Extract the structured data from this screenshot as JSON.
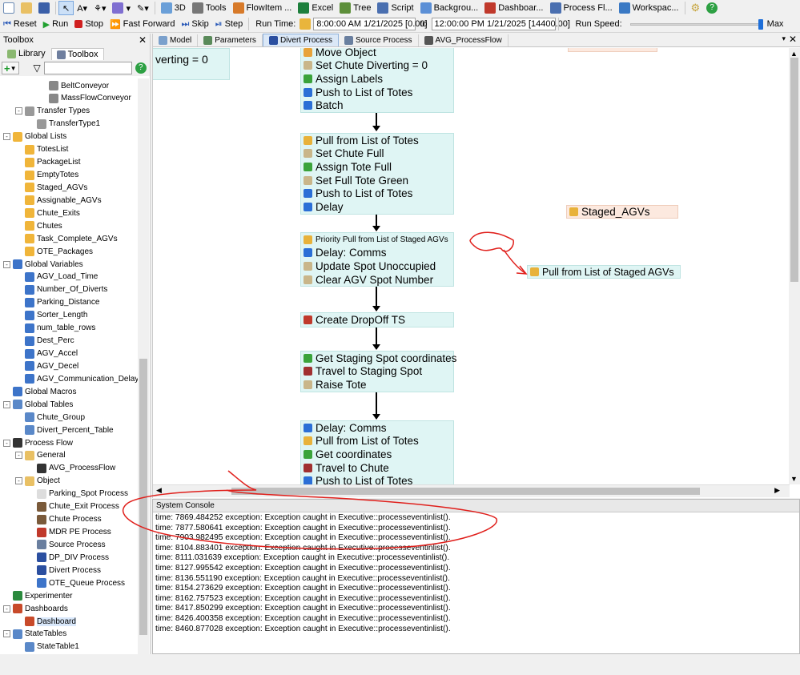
{
  "toolbar1": {
    "items": [
      {
        "label": "3D",
        "icon": "3d-view-icon"
      },
      {
        "label": "Tools",
        "icon": "tools-icon"
      },
      {
        "label": "FlowItem ...",
        "icon": "flowitem-icon"
      },
      {
        "label": "Excel",
        "icon": "excel-icon"
      },
      {
        "label": "Tree",
        "icon": "tree-icon"
      },
      {
        "label": "Script",
        "icon": "script-icon"
      },
      {
        "label": "Backgrou...",
        "icon": "background-icon"
      },
      {
        "label": "Dashboar...",
        "icon": "dashboard-icon"
      },
      {
        "label": "Process Fl...",
        "icon": "process-flow-icon"
      },
      {
        "label": "Workspac...",
        "icon": "workspace-icon"
      }
    ]
  },
  "toolbar2": {
    "reset": "Reset",
    "run": "Run",
    "stop": "Stop",
    "fast_forward": "Fast Forward",
    "skip": "Skip",
    "step": "Step",
    "run_time_label": "Run Time:",
    "start_time": "8:00:00 AM  1/21/2025 [0.00]",
    "to": "to",
    "end_time": "12:00:00 PM  1/21/2025 [14400.00]",
    "run_speed_label": "Run Speed:",
    "run_speed_level": 0.97,
    "max_label": "Max"
  },
  "toolbox": {
    "title": "Toolbox",
    "tabs": [
      "Library",
      "Toolbox"
    ],
    "filter_value": "",
    "tree": [
      {
        "indent": 3,
        "label": "BeltConveyor",
        "icon": "conveyor-icon",
        "expander": ""
      },
      {
        "indent": 3,
        "label": "MassFlowConveyor",
        "icon": "conveyor-icon",
        "expander": ""
      },
      {
        "indent": 1,
        "label": "Transfer Types",
        "icon": "transfer-icon",
        "expander": "-"
      },
      {
        "indent": 2,
        "label": "TransferType1",
        "icon": "transfer-icon",
        "expander": ""
      },
      {
        "indent": 0,
        "label": "Global Lists",
        "icon": "list-icon",
        "expander": "-"
      },
      {
        "indent": 1,
        "label": "TotesList",
        "icon": "list-icon",
        "expander": ""
      },
      {
        "indent": 1,
        "label": "PackageList",
        "icon": "list-icon",
        "expander": ""
      },
      {
        "indent": 1,
        "label": "EmptyTotes",
        "icon": "list-icon",
        "expander": ""
      },
      {
        "indent": 1,
        "label": "Staged_AGVs",
        "icon": "list-icon",
        "expander": ""
      },
      {
        "indent": 1,
        "label": "Assignable_AGVs",
        "icon": "list-icon",
        "expander": ""
      },
      {
        "indent": 1,
        "label": "Chute_Exits",
        "icon": "list-icon",
        "expander": ""
      },
      {
        "indent": 1,
        "label": "Chutes",
        "icon": "list-icon",
        "expander": ""
      },
      {
        "indent": 1,
        "label": "Task_Complete_AGVs",
        "icon": "list-icon",
        "expander": ""
      },
      {
        "indent": 1,
        "label": "OTE_Packages",
        "icon": "list-icon",
        "expander": ""
      },
      {
        "indent": 0,
        "label": "Global Variables",
        "icon": "variable-icon",
        "expander": "-"
      },
      {
        "indent": 1,
        "label": "AGV_Load_Time",
        "icon": "variable-icon",
        "expander": ""
      },
      {
        "indent": 1,
        "label": "Number_Of_Diverts",
        "icon": "variable-icon",
        "expander": ""
      },
      {
        "indent": 1,
        "label": "Parking_Distance",
        "icon": "variable-icon",
        "expander": ""
      },
      {
        "indent": 1,
        "label": "Sorter_Length",
        "icon": "variable-icon",
        "expander": ""
      },
      {
        "indent": 1,
        "label": "num_table_rows",
        "icon": "variable-icon",
        "expander": ""
      },
      {
        "indent": 1,
        "label": "Dest_Perc",
        "icon": "variable-icon",
        "expander": ""
      },
      {
        "indent": 1,
        "label": "AGV_Accel",
        "icon": "variable-icon",
        "expander": ""
      },
      {
        "indent": 1,
        "label": "AGV_Decel",
        "icon": "variable-icon",
        "expander": ""
      },
      {
        "indent": 1,
        "label": "AGV_Communication_Delay",
        "icon": "variable-icon",
        "expander": ""
      },
      {
        "indent": 0,
        "label": "Global Macros",
        "icon": "macro-icon",
        "expander": ""
      },
      {
        "indent": 0,
        "label": "Global Tables",
        "icon": "table-icon",
        "expander": "-"
      },
      {
        "indent": 1,
        "label": "Chute_Group",
        "icon": "table-icon",
        "expander": ""
      },
      {
        "indent": 1,
        "label": "Divert_Percent_Table",
        "icon": "table-icon",
        "expander": ""
      },
      {
        "indent": 0,
        "label": "Process Flow",
        "icon": "process-flow-icon",
        "expander": "-"
      },
      {
        "indent": 1,
        "label": "General",
        "icon": "folder-icon",
        "expander": "-"
      },
      {
        "indent": 2,
        "label": "AVG_ProcessFlow",
        "icon": "process-flow-icon",
        "expander": ""
      },
      {
        "indent": 1,
        "label": "Object",
        "icon": "folder-icon",
        "expander": "-"
      },
      {
        "indent": 2,
        "label": "Parking_Spot Process",
        "icon": "parking-icon",
        "expander": ""
      },
      {
        "indent": 2,
        "label": "Chute_Exit Process",
        "icon": "chute-icon",
        "expander": ""
      },
      {
        "indent": 2,
        "label": "Chute Process",
        "icon": "chute-icon",
        "expander": ""
      },
      {
        "indent": 2,
        "label": "MDR PE Process",
        "icon": "sensor-icon",
        "expander": ""
      },
      {
        "indent": 2,
        "label": "Source Process",
        "icon": "source-icon",
        "expander": ""
      },
      {
        "indent": 2,
        "label": "DP_DIV Process",
        "icon": "divert-icon",
        "expander": ""
      },
      {
        "indent": 2,
        "label": "Divert Process",
        "icon": "divert-icon",
        "expander": ""
      },
      {
        "indent": 2,
        "label": "OTE_Queue Process",
        "icon": "queue-icon",
        "expander": ""
      },
      {
        "indent": 0,
        "label": "Experimenter",
        "icon": "experimenter-icon",
        "expander": ""
      },
      {
        "indent": 0,
        "label": "Dashboards",
        "icon": "dashboard-icon",
        "expander": "-"
      },
      {
        "indent": 1,
        "label": "Dashboard",
        "icon": "dashboard-icon",
        "expander": "",
        "selected": true
      },
      {
        "indent": 0,
        "label": "StateTables",
        "icon": "table-icon",
        "expander": "-"
      },
      {
        "indent": 1,
        "label": "StateTable1",
        "icon": "table-icon",
        "expander": ""
      }
    ]
  },
  "editor": {
    "tabs": [
      {
        "label": "Model",
        "icon": "model-icon"
      },
      {
        "label": "Parameters",
        "icon": "parameters-icon"
      },
      {
        "label": "Divert Process",
        "icon": "divert-icon",
        "active": true
      },
      {
        "label": "Source Process",
        "icon": "source-icon"
      },
      {
        "label": "AVG_ProcessFlow",
        "icon": "process-flow-icon"
      }
    ],
    "partial_label": "verting = 0",
    "blocks": [
      {
        "activities": [
          {
            "label": "Move Object",
            "icon": "move-icon",
            "color": "#e8a33a"
          },
          {
            "label": "Set Chute Diverting = 0",
            "icon": "set-label-icon",
            "color": "#c9b68a"
          },
          {
            "label": "Assign Labels",
            "icon": "assign-labels-icon",
            "color": "#3aa33a"
          },
          {
            "label": "Push to List of Totes",
            "icon": "push-list-icon",
            "color": "#2b6fd6"
          },
          {
            "label": "Batch",
            "icon": "batch-icon",
            "color": "#2b6fd6"
          }
        ]
      },
      {
        "activities": [
          {
            "label": "Pull from List of Totes",
            "icon": "pull-list-icon",
            "color": "#e8b23a"
          },
          {
            "label": "Set Chute Full",
            "icon": "set-label-icon",
            "color": "#c9b68a"
          },
          {
            "label": "Assign Tote Full",
            "icon": "assign-labels-icon",
            "color": "#3aa33a"
          },
          {
            "label": "Set Full Tote Green",
            "icon": "set-label-icon",
            "color": "#c9b68a"
          },
          {
            "label": "Push to List of Totes",
            "icon": "push-list-icon",
            "color": "#2b6fd6"
          },
          {
            "label": "Delay",
            "icon": "delay-icon",
            "color": "#2b6fd6"
          }
        ]
      },
      {
        "activities": [
          {
            "label": "Priority Pull from List of Staged AGVs",
            "icon": "pull-list-icon",
            "color": "#e8b23a",
            "small": true
          },
          {
            "label": "Delay: Comms",
            "icon": "delay-icon",
            "color": "#2b6fd6"
          },
          {
            "label": "Update Spot Unoccupied",
            "icon": "set-label-icon",
            "color": "#c9b68a"
          },
          {
            "label": "Clear AGV Spot Number",
            "icon": "set-label-icon",
            "color": "#c9b68a"
          }
        ]
      },
      {
        "activities": [
          {
            "label": "Create DropOff TS",
            "icon": "create-task-icon",
            "color": "#c0392b"
          }
        ]
      },
      {
        "activities": [
          {
            "label": "Get Staging Spot coordinates",
            "icon": "assign-labels-icon",
            "color": "#3aa33a"
          },
          {
            "label": "Travel to Staging Spot",
            "icon": "travel-icon",
            "color": "#a03030"
          },
          {
            "label": "Raise Tote",
            "icon": "set-label-icon",
            "color": "#c9b68a"
          }
        ]
      },
      {
        "activities": [
          {
            "label": "Delay: Comms",
            "icon": "delay-icon",
            "color": "#2b6fd6"
          },
          {
            "label": "Pull from List of Totes",
            "icon": "pull-list-icon",
            "color": "#e8b23a"
          },
          {
            "label": "Get coordinates",
            "icon": "assign-labels-icon",
            "color": "#3aa33a"
          },
          {
            "label": "Travel to Chute",
            "icon": "travel-icon",
            "color": "#a03030"
          },
          {
            "label": "Push to List of Totes",
            "icon": "push-list-icon",
            "color": "#2b6fd6"
          }
        ]
      }
    ],
    "staged_agvs_label": "Staged_AGVs",
    "pull_staged_label": "Pull from List of Staged AGVs"
  },
  "console": {
    "title": "System Console",
    "lines": [
      "time: 7869.484252 exception: Exception caught in Executive::processeventinlist().",
      "time: 7877.580641 exception: Exception caught in Executive::processeventinlist().",
      "time: 7903.982495 exception: Exception caught in Executive::processeventinlist().",
      "time: 8104.883401 exception: Exception caught in Executive::processeventinlist().",
      "time: 8111.031639 exception: Exception caught in Executive::processeventinlist().",
      "time: 8127.995542 exception: Exception caught in Executive::processeventinlist().",
      "time: 8136.551190 exception: Exception caught in Executive::processeventinlist().",
      "time: 8154.273629 exception: Exception caught in Executive::processeventinlist().",
      "time: 8162.757523 exception: Exception caught in Executive::processeventinlist().",
      "time: 8417.850299 exception: Exception caught in Executive::processeventinlist().",
      "time: 8426.400358 exception: Exception caught in Executive::processeventinlist().",
      "time: 8460.877028 exception: Exception caught in Executive::processeventinlist()."
    ]
  },
  "colors": {
    "block_fill": "#dff5f4",
    "block_border": "#bfe4e2",
    "staged_fill": "#fce9df",
    "annotation": "#e0201c",
    "selection": "#d9e8fb"
  }
}
